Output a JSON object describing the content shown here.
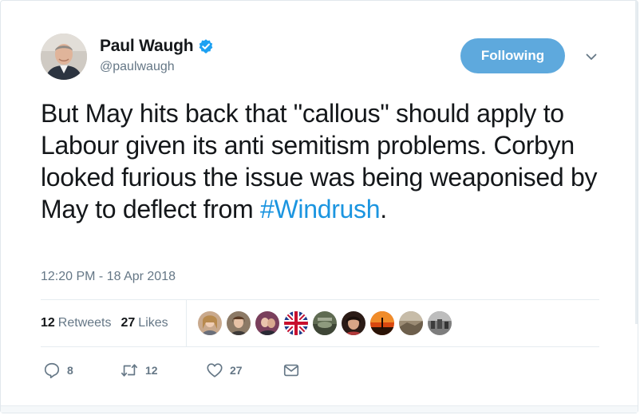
{
  "author": {
    "display_name": "Paul Waugh",
    "handle": "@paulwaugh",
    "verified": true
  },
  "follow_button": {
    "label": "Following"
  },
  "tweet": {
    "text_before": "But May hits back that \"callous\" should apply to Labour given its anti semitism problems. Corbyn looked furious the issue was being weaponised by May to deflect from ",
    "hashtag": "#Windrush",
    "text_after": ".",
    "timestamp": "12:20 PM - 18 Apr 2018"
  },
  "stats": {
    "retweets_count": "12",
    "retweets_label": "Retweets",
    "likes_count": "27",
    "likes_label": "Likes"
  },
  "actions": {
    "reply_count": "8",
    "retweet_count": "12",
    "like_count": "27"
  },
  "colors": {
    "accent": "#1b95e0",
    "follow_button_bg": "#5ea9dd",
    "text_primary": "#14171a",
    "text_secondary": "#657786"
  },
  "icons": {
    "verified": "verified-badge-icon",
    "caret": "chevron-down-icon",
    "reply": "reply-icon",
    "retweet": "retweet-icon",
    "like": "heart-icon",
    "dm": "envelope-icon"
  }
}
